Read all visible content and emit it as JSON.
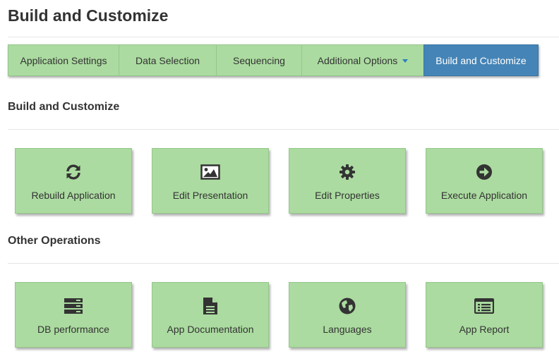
{
  "page": {
    "title": "Build and Customize"
  },
  "tabs": [
    {
      "label": "Application Settings"
    },
    {
      "label": "Data Selection"
    },
    {
      "label": "Sequencing"
    },
    {
      "label": "Additional Options"
    },
    {
      "label": "Build and Customize",
      "active": true
    }
  ],
  "sections": {
    "build": {
      "title": "Build and Customize",
      "cards": [
        {
          "label": "Rebuild Application",
          "icon": "refresh-icon"
        },
        {
          "label": "Edit Presentation",
          "icon": "image-icon"
        },
        {
          "label": "Edit Properties",
          "icon": "gear-icon"
        },
        {
          "label": "Execute Application",
          "icon": "arrow-circle-right-icon"
        }
      ]
    },
    "other": {
      "title": "Other Operations",
      "cards": [
        {
          "label": "DB performance",
          "icon": "server-icon"
        },
        {
          "label": "App Documentation",
          "icon": "document-icon"
        },
        {
          "label": "Languages",
          "icon": "globe-icon"
        },
        {
          "label": "App Report",
          "icon": "list-alt-icon"
        }
      ]
    }
  },
  "colors": {
    "card_bg": "#abdba0",
    "active_tab": "#4584b6",
    "text": "#333333"
  }
}
